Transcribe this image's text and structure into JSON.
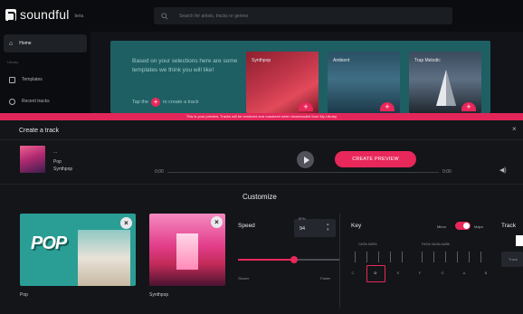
{
  "app": {
    "name": "soundful",
    "badge": "beta"
  },
  "search": {
    "placeholder": "Search for artists, tracks or genres"
  },
  "sidebar": {
    "items": [
      {
        "label": "Home"
      },
      {
        "label": "Templates"
      },
      {
        "label": "Recent tracks"
      }
    ],
    "section": "Library"
  },
  "banner": {
    "text": "Based on your selections here are some templates we think you will like!",
    "tap_prefix": "Tap the",
    "tap_suffix": "to create a track",
    "cards": [
      {
        "label": "Synthpop"
      },
      {
        "label": "Ambient"
      },
      {
        "label": "Trap Melodic"
      }
    ]
  },
  "notice": {
    "text": "This is your preview. Tracks will be rendered and mastered when downloaded from My Library"
  },
  "create_track": {
    "title": "Create a track",
    "track": {
      "name": "...",
      "genre": "Pop",
      "style": "Synthpop"
    },
    "time_start": "0:00",
    "time_end": "0:00",
    "preview_label": "CREATE PREVIEW"
  },
  "customize": {
    "title": "Customize",
    "cards": [
      {
        "label": "Pop",
        "art_text": "POP"
      },
      {
        "label": "Synthpop"
      }
    ],
    "speed": {
      "label": "Speed",
      "bpm_caption": "BPM",
      "bpm": "94",
      "slider_value": 0.55,
      "slow_label": "Slower",
      "fast_label": "Faster"
    },
    "key": {
      "label": "Key",
      "minor_label": "Minor",
      "major_label": "Major",
      "mode_is_major": true,
      "sharps_left": "C#/Db  D#/Eb",
      "sharps_right": "F#/Gb  G#/Ab  A#/Bb",
      "naturals": [
        "C",
        "D",
        "E",
        "F",
        "G",
        "A",
        "B"
      ],
      "selected": "D"
    },
    "track_label": "Track",
    "track_box": "Track"
  },
  "colors": {
    "accent": "#e8275a",
    "banner": "#1e5f63",
    "bg": "#131518"
  }
}
